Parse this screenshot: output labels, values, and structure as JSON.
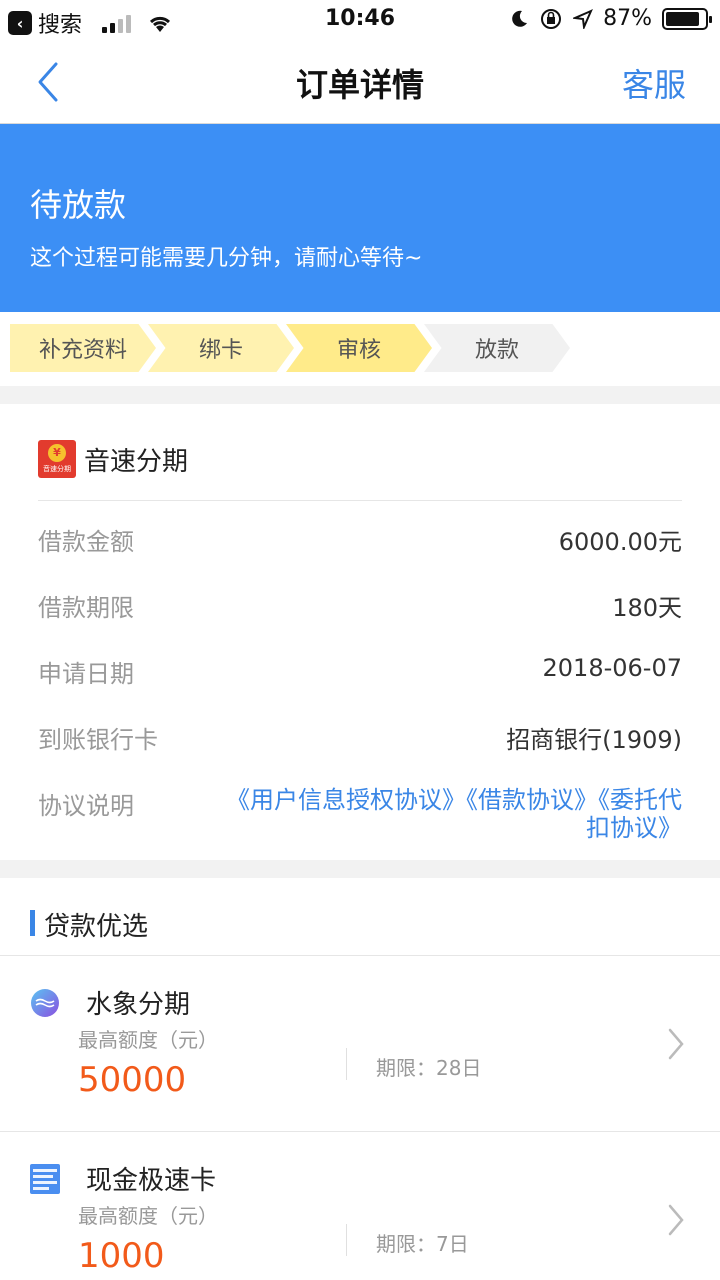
{
  "status_bar": {
    "back_app": "搜索",
    "time": "10:46",
    "battery": "87%",
    "battery_level": 0.87
  },
  "nav": {
    "title": "订单详情",
    "service": "客服"
  },
  "banner": {
    "title": "待放款",
    "subtitle": "这个过程可能需要几分钟，请耐心等待~"
  },
  "steps": [
    {
      "label": "补充资料",
      "state": "done"
    },
    {
      "label": "绑卡",
      "state": "done"
    },
    {
      "label": "审核",
      "state": "active"
    },
    {
      "label": "放款",
      "state": "todo"
    }
  ],
  "order": {
    "brand_name": "音速分期",
    "brand_logo_text": "音速分期",
    "rows": [
      {
        "label": "借款金额",
        "value": "6000.00元"
      },
      {
        "label": "借款期限",
        "value": "180天"
      },
      {
        "label": "申请日期",
        "value": "2018-06-07"
      },
      {
        "label": "到账银行卡",
        "value": "招商银行(1909)"
      }
    ],
    "agreement_label": "协议说明",
    "agreements": [
      "《用户信息授权协议》",
      "《借款协议》",
      "《委托代扣协议》"
    ]
  },
  "recommend": {
    "title": "贷款优选",
    "items": [
      {
        "name": "水象分期",
        "limit_label": "最高额度（元）",
        "amount": "50000",
        "term": "期限：28日"
      },
      {
        "name": "现金极速卡",
        "limit_label": "最高额度（元）",
        "amount": "1000",
        "term": "期限：7日"
      }
    ]
  },
  "colors": {
    "accent": "#3a86e6",
    "banner": "#3c8ff5",
    "amount": "#f25a1a"
  }
}
